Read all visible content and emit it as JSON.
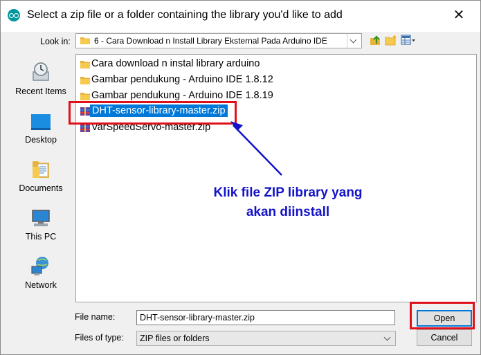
{
  "window": {
    "title": "Select a zip file or a folder containing the library you'd like to add"
  },
  "lookin": {
    "label": "Look in:",
    "value": "6 - Cara Download n Install Library Eksternal Pada Arduino IDE"
  },
  "places": [
    {
      "label": "Recent Items",
      "icon": "recent-items-icon"
    },
    {
      "label": "Desktop",
      "icon": "desktop-icon"
    },
    {
      "label": "Documents",
      "icon": "documents-icon"
    },
    {
      "label": "This PC",
      "icon": "this-pc-icon"
    },
    {
      "label": "Network",
      "icon": "network-icon"
    }
  ],
  "files": [
    {
      "name": "Cara download n instal library arduino",
      "type": "folder"
    },
    {
      "name": "Gambar pendukung - Arduino IDE 1.8.12",
      "type": "folder"
    },
    {
      "name": "Gambar pendukung - Arduino IDE 1.8.19",
      "type": "folder"
    },
    {
      "name": "DHT-sensor-library-master.zip",
      "type": "zip",
      "selected": true
    },
    {
      "name": "VarSpeedServo-master.zip",
      "type": "zip"
    }
  ],
  "annotation": {
    "line1": "Klik file ZIP library yang",
    "line2": "akan diinstall"
  },
  "filename": {
    "label": "File name:",
    "value": "DHT-sensor-library-master.zip"
  },
  "filetype": {
    "label": "Files of type:",
    "value": "ZIP files or folders"
  },
  "buttons": {
    "open": "Open",
    "cancel": "Cancel"
  },
  "colors": {
    "selection": "#0078d7",
    "annotation": "#1212c8",
    "highlight": "#e0101a"
  }
}
